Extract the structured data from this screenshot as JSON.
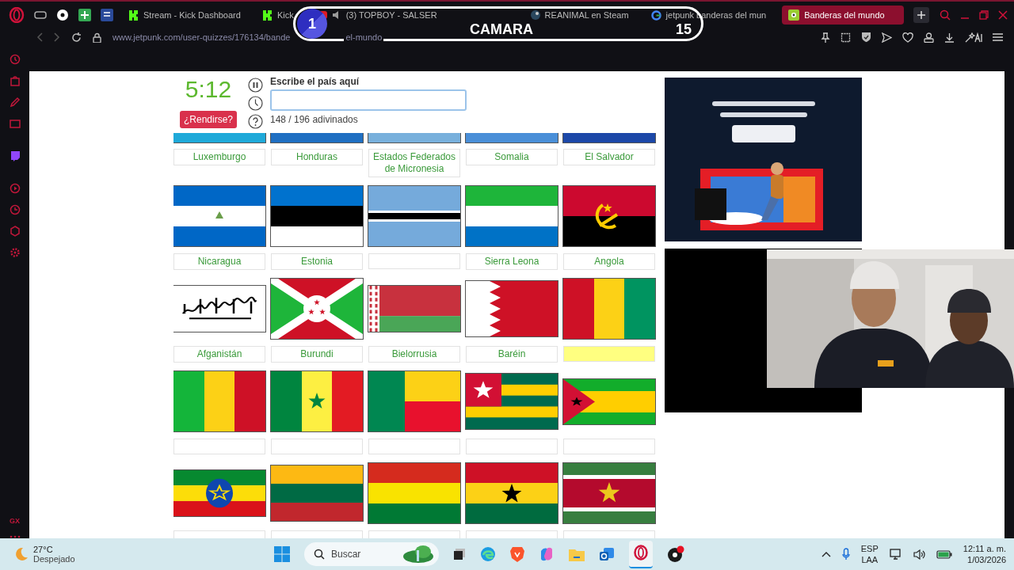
{
  "browser": {
    "tabs": [
      {
        "label": "Stream - Kick Dashboard",
        "kind": "kick",
        "selected": false
      },
      {
        "label": "Kick",
        "kind": "kick",
        "selected": false
      },
      {
        "label": "(3) TOPBOY - SALSER",
        "kind": "video",
        "selected": false
      },
      {
        "label": "REANIMAL en Steam",
        "kind": "steam",
        "selected": false
      },
      {
        "label": "jetpunk banderas del mun",
        "kind": "search",
        "selected": false
      },
      {
        "label": "Banderas del mundo",
        "kind": "quiz",
        "selected": true
      }
    ],
    "url_start": "www.jetpunk.com/user-quizzes/176134/bande",
    "url_end": "el-mundo"
  },
  "sidebar": {
    "logo": "GX"
  },
  "stream_overlay": {
    "badge": "1",
    "title": "CAMARA",
    "count": "15"
  },
  "quiz": {
    "timer": "5:12",
    "give_up": "¿Rendirse?",
    "prompt": "Escribe el país aquí",
    "progress": "148 / 196 adivinados",
    "rows": [
      {
        "cells": [
          {
            "kind": "strip",
            "color": "#1fa9d9",
            "answer": "Luxemburgo",
            "highlighted": false
          },
          {
            "kind": "strip",
            "color": "#1f6fc2",
            "answer": "Honduras",
            "highlighted": false
          },
          {
            "kind": "strip",
            "color": "#78b0dc",
            "answer": "Estados Federados de Micronesia",
            "highlighted": false
          },
          {
            "kind": "strip",
            "color": "#4a8fd8",
            "answer": "Somalia",
            "highlighted": false
          },
          {
            "kind": "strip",
            "color": "#1c48a8",
            "answer": "El Salvador",
            "highlighted": false
          }
        ]
      },
      {
        "cells": [
          {
            "kind": "nicaragua",
            "answer": "Nicaragua",
            "highlighted": false
          },
          {
            "kind": "estonia",
            "answer": "Estonia",
            "highlighted": false
          },
          {
            "kind": "botswana",
            "highlighted": false
          },
          {
            "kind": "sierraleone",
            "answer": "Sierra Leona",
            "highlighted": false
          },
          {
            "kind": "angola",
            "answer": "Angola",
            "highlighted": false
          }
        ]
      },
      {
        "cells": [
          {
            "kind": "afghanistan",
            "answer": "Afganistán",
            "highlighted": false
          },
          {
            "kind": "burundi",
            "answer": "Burundi",
            "highlighted": false
          },
          {
            "kind": "belarus",
            "answer": "Bielorrusia",
            "highlighted": false
          },
          {
            "kind": "bahrain",
            "answer": "Baréin",
            "highlighted": false
          },
          {
            "kind": "guinea",
            "highlighted": true
          }
        ]
      },
      {
        "cells": [
          {
            "kind": "mali",
            "highlighted": false
          },
          {
            "kind": "senegal",
            "highlighted": false
          },
          {
            "kind": "benin",
            "highlighted": false
          },
          {
            "kind": "togo",
            "highlighted": false
          },
          {
            "kind": "saotome",
            "highlighted": false
          }
        ]
      },
      {
        "cells": [
          {
            "kind": "ethiopia",
            "highlighted": false
          },
          {
            "kind": "lithuania",
            "highlighted": false
          },
          {
            "kind": "bolivia",
            "highlighted": false
          },
          {
            "kind": "ghana",
            "highlighted": false
          },
          {
            "kind": "suriname",
            "highlighted": false
          }
        ]
      }
    ]
  },
  "taskbar": {
    "temperature": "27°C",
    "weather": "Despejado",
    "search_placeholder": "Buscar",
    "language": "ESP",
    "layout": "LAA",
    "time": "12:11 a. m.",
    "date": "1/03/2026"
  }
}
